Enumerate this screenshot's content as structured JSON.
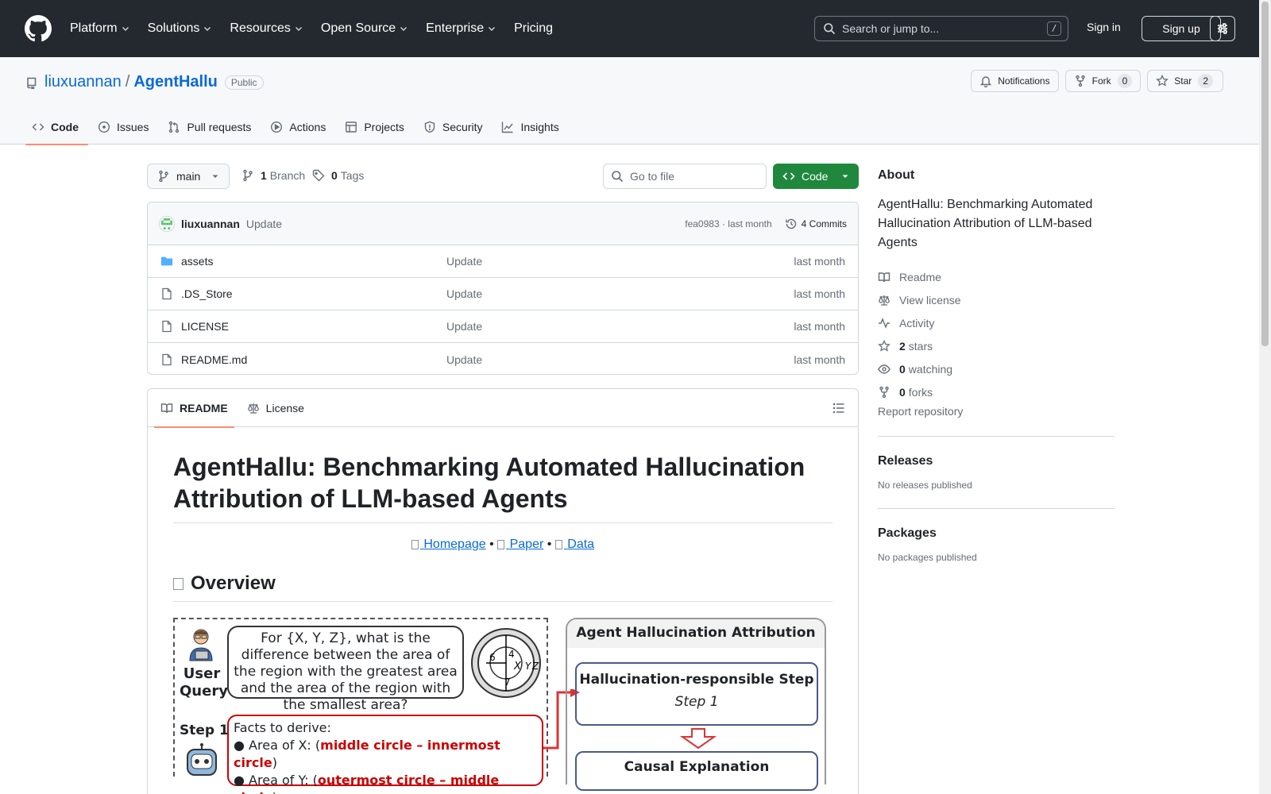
{
  "header": {
    "nav": [
      {
        "label": "Platform",
        "dropdown": true
      },
      {
        "label": "Solutions",
        "dropdown": true
      },
      {
        "label": "Resources",
        "dropdown": true
      },
      {
        "label": "Open Source",
        "dropdown": true
      },
      {
        "label": "Enterprise",
        "dropdown": true
      },
      {
        "label": "Pricing",
        "dropdown": false
      }
    ],
    "search_placeholder": "Search or jump to...",
    "search_shortcut": "/",
    "sign_in": "Sign in",
    "sign_up": "Sign up"
  },
  "repo": {
    "owner": "liuxuannan",
    "separator": "/",
    "name": "AgentHallu",
    "visibility": "Public",
    "notifications_label": "Notifications",
    "fork_label": "Fork",
    "fork_count": "0",
    "star_label": "Star",
    "star_count": "2",
    "tabs": [
      {
        "label": "Code",
        "icon": "code-icon",
        "selected": true
      },
      {
        "label": "Issues",
        "icon": "issue-icon",
        "selected": false
      },
      {
        "label": "Pull requests",
        "icon": "pull-request-icon",
        "selected": false
      },
      {
        "label": "Actions",
        "icon": "play-icon",
        "selected": false
      },
      {
        "label": "Projects",
        "icon": "table-icon",
        "selected": false
      },
      {
        "label": "Security",
        "icon": "shield-icon",
        "selected": false
      },
      {
        "label": "Insights",
        "icon": "graph-icon",
        "selected": false
      }
    ]
  },
  "toolbar": {
    "branch": "main",
    "branch_count": "1",
    "branch_label": "Branch",
    "tag_count": "0",
    "tag_label": "Tags",
    "goto_placeholder": "Go to file",
    "code_button": "Code"
  },
  "commit": {
    "user": "liuxuannan",
    "message": "Update",
    "hash_time": "fea0983 · last month",
    "count": "4 Commits"
  },
  "files": [
    {
      "name": "assets",
      "type": "folder",
      "message": "Update",
      "time": "last month"
    },
    {
      "name": ".DS_Store",
      "type": "file",
      "message": "Update",
      "time": "last month"
    },
    {
      "name": "LICENSE",
      "type": "file",
      "message": "Update",
      "time": "last month"
    },
    {
      "name": "README.md",
      "type": "file",
      "message": "Update",
      "time": "last month"
    }
  ],
  "readme": {
    "tab_readme": "README",
    "tab_license": "License",
    "title": "AgentHallu: Benchmarking Automated Hallucination Attribution of LLM-based Agents",
    "links": [
      {
        "label": "Homepage"
      },
      {
        "label": "Paper"
      },
      {
        "label": "Data"
      }
    ],
    "link_separator": "•",
    "overview_heading": "Overview",
    "figure": {
      "user_label": "User Query",
      "query": "For {X, Y, Z}, what is the difference between the area of the region with the greatest area and the area of the region with the smallest area?",
      "circle_labels": {
        "n6": "6",
        "n4": "4",
        "n7": "7",
        "x": "X",
        "y": "Y",
        "z": "Z"
      },
      "step_label": "Step 1",
      "facts_title": "Facts to derive:",
      "fact1_prefix": "● Area of X: (",
      "fact1_red": "middle circle – innermost circle",
      "fact1_suffix": ")",
      "fact2_prefix": "● Area of Y: (",
      "fact2_red": "outermost circle – middle circle",
      "fact2_suffix": ")",
      "attr_title": "Agent Hallucination Attribution",
      "step_box_title": "Hallucination-responsible Step",
      "step_box_value": "Step 1",
      "causal_title": "Causal Explanation"
    }
  },
  "about": {
    "heading": "About",
    "description": "AgentHallu: Benchmarking Automated Hallucination Attribution of LLM-based Agents",
    "readme": "Readme",
    "license": "View license",
    "activity": "Activity",
    "stars_count": "2",
    "stars_label": "stars",
    "watching_count": "0",
    "watching_label": "watching",
    "forks_count": "0",
    "forks_label": "forks",
    "report": "Report repository"
  },
  "releases": {
    "heading": "Releases",
    "text": "No releases published"
  },
  "packages": {
    "heading": "Packages",
    "text": "No packages published"
  },
  "colors": {
    "header_bg": "#24292f",
    "link": "#0969da",
    "code_button": "#1f883d",
    "tab_underline": "#fd8c73"
  }
}
